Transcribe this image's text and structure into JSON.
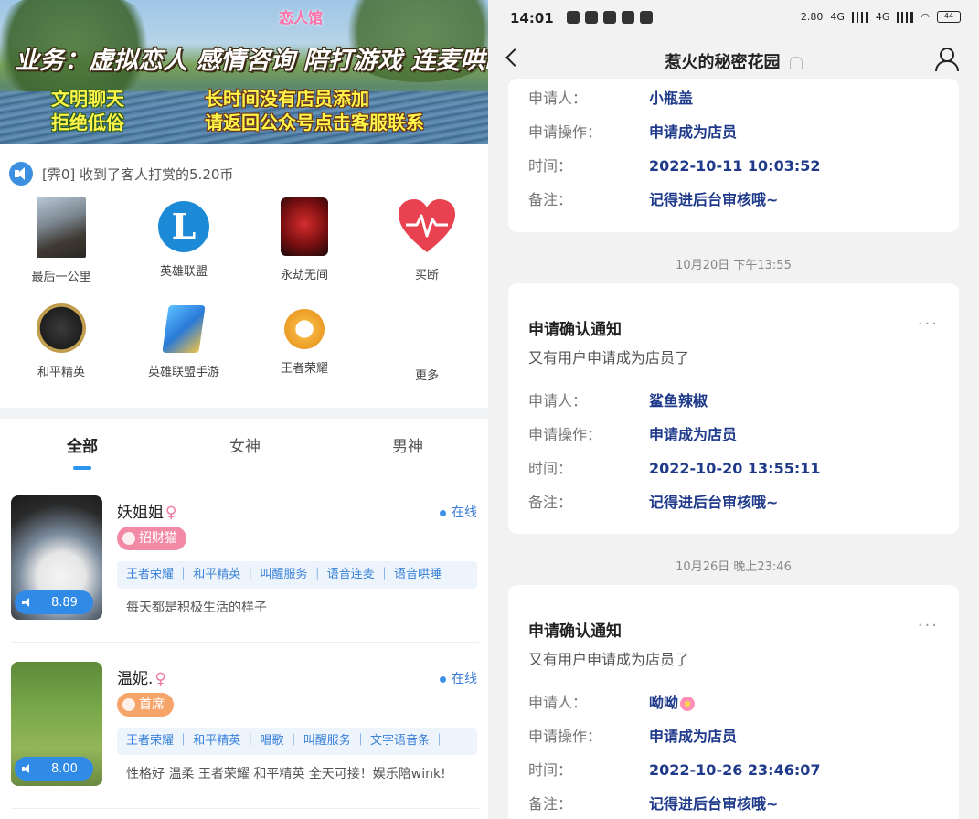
{
  "banner": {
    "logo": "恋人馆",
    "title": "业务：虚拟恋人 感情咨询 陪打游戏 连麦哄睡",
    "left_line1": "文明聊天",
    "left_line2": "拒绝低俗",
    "right_line1": "长时间没有店员添加",
    "right_line2": "请返回公众号点击客服联系"
  },
  "notice": {
    "text": "[霁0] 收到了客人打赏的5.20币"
  },
  "categories": [
    {
      "label": "最后一公里",
      "icon": "photo-icon"
    },
    {
      "label": "英雄联盟",
      "icon": "lol-icon"
    },
    {
      "label": "永劫无间",
      "icon": "yongjie-icon"
    },
    {
      "label": "买断",
      "icon": "heart-pulse-icon"
    },
    {
      "label": "和平精英",
      "icon": "peace-elite-icon"
    },
    {
      "label": "英雄联盟手游",
      "icon": "lol-mobile-icon"
    },
    {
      "label": "王者荣耀",
      "icon": "honor-of-kings-icon"
    },
    {
      "label": "更多",
      "icon": ""
    }
  ],
  "tabs": [
    "全部",
    "女神",
    "男神"
  ],
  "active_tab": "全部",
  "profiles": [
    {
      "name": "妖姐姐",
      "gender_symbol": "♀",
      "status": "在线",
      "badge": "招财猫",
      "tags": "王者荣耀 ｜ 和平精英 ｜ 叫醒服务 ｜ 语音连麦 ｜ 语音哄睡",
      "bio": "每天都是积极生活的样子",
      "price": "8.89"
    },
    {
      "name": "温妮.",
      "gender_symbol": "♀",
      "status": "在线",
      "badge": "首席",
      "tags": "王者荣耀 ｜ 和平精英 ｜ 唱歌 ｜ 叫醒服务 ｜ 文字语音条 ｜",
      "bio": "性格好 温柔 王者荣耀 和平精英 全天可接！娱乐陪wink!",
      "price": "8.00"
    }
  ],
  "statusbar": {
    "time": "14:01",
    "net_speed": "2.80",
    "net_type1": "4G",
    "net_type2": "4G",
    "battery": "44"
  },
  "chat": {
    "title": "惹火的秘密花园",
    "partial_card": {
      "applicant_label": "申请人：",
      "applicant": "小瓶盖",
      "action_label": "申请操作：",
      "action": "申请成为店员",
      "time_label": "时间：",
      "time": "2022-10-11 10:03:52",
      "note_label": "备注：",
      "note": "记得进后台审核哦~"
    },
    "messages": [
      {
        "timestamp": "10月20日 下午13:55",
        "title": "申请确认通知",
        "subtitle": "又有用户申请成为店员了",
        "applicant_label": "申请人：",
        "applicant": "鲨鱼辣椒",
        "action_label": "申请操作：",
        "action": "申请成为店员",
        "time_label": "时间：",
        "time": "2022-10-20 13:55:11",
        "note_label": "备注：",
        "note": "记得进后台审核哦~",
        "more": "···"
      },
      {
        "timestamp": "10月26日 晚上23:46",
        "title": "申请确认通知",
        "subtitle": "又有用户申请成为店员了",
        "applicant_label": "申请人：",
        "applicant": "呦呦",
        "action_label": "申请操作：",
        "action": "申请成为店员",
        "time_label": "时间：",
        "time": "2022-10-26 23:46:07",
        "note_label": "备注：",
        "note": "记得进后台审核哦~",
        "more": "···"
      }
    ]
  }
}
